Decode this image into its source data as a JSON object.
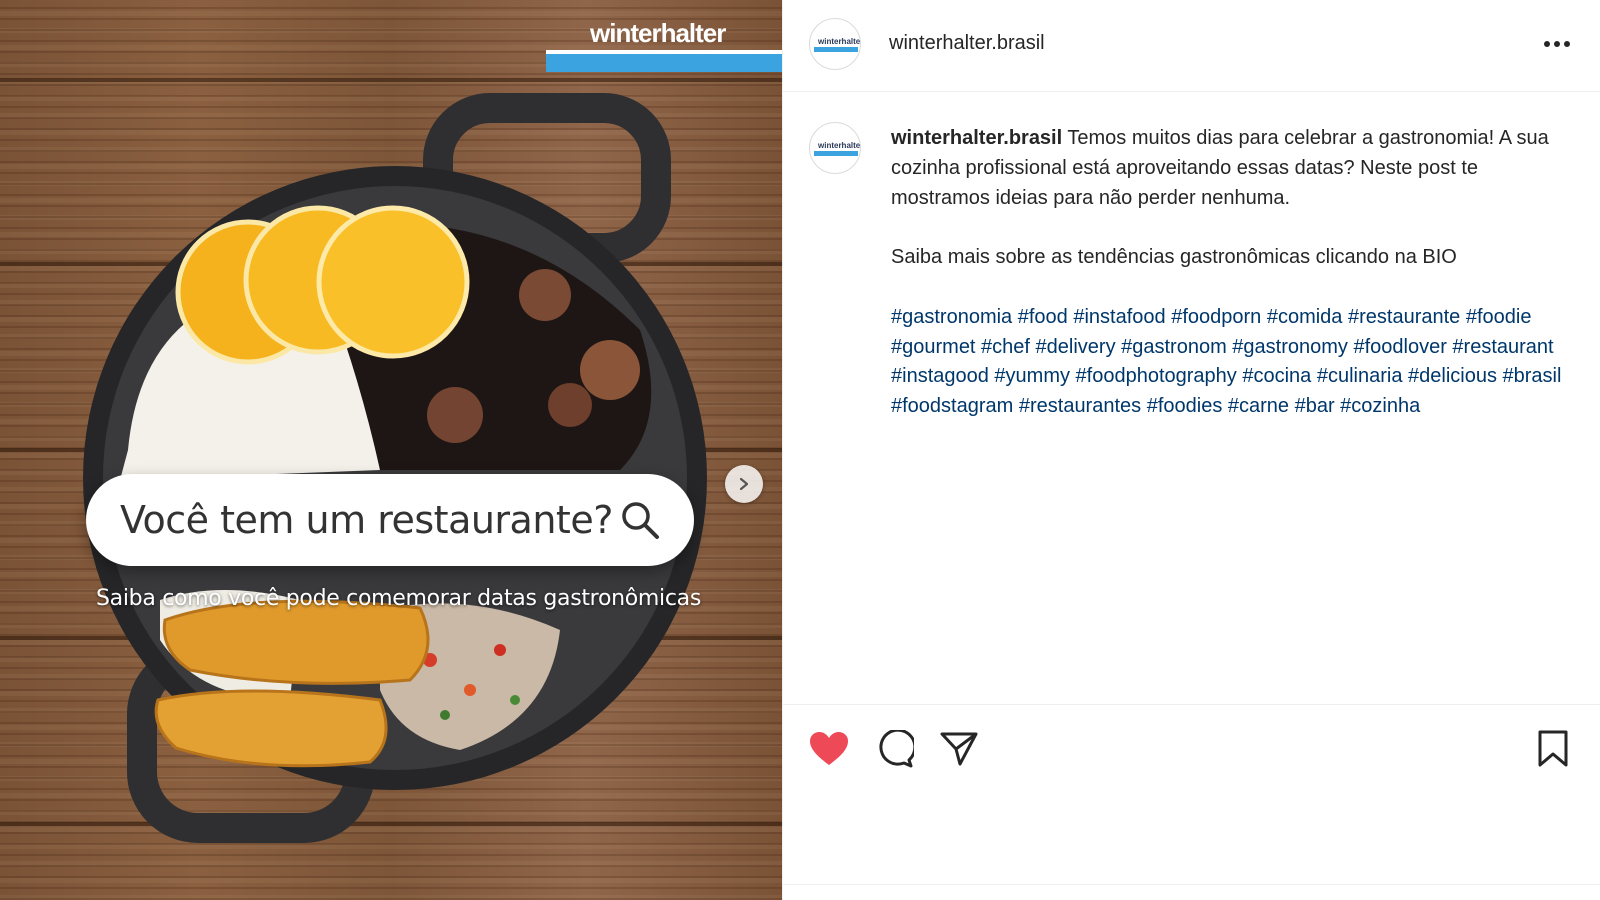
{
  "media": {
    "brand_logo": "winterhalter",
    "search_text": "Você tem um restaurante?",
    "subtitle": "Saiba como você pode comemorar datas gastronômicas",
    "next_icon": "chevron-right-icon"
  },
  "header": {
    "avatar_text": "winterhalter",
    "username": "winterhalter.brasil",
    "more_icon": "more-horizontal-icon"
  },
  "caption": {
    "avatar_text": "winterhalter",
    "username": "winterhalter.brasil",
    "paragraph_1": "Temos muitos dias para celebrar a gastronomia! A sua cozinha profissional está aproveitando essas datas? Neste post te mostramos ideias para não perder nenhuma.",
    "paragraph_2": "Saiba mais sobre as tendências gastronômicas clicando na BIO",
    "hashtags": "#gastronomia #food #instafood #foodporn #comida #restaurante #foodie #gourmet #chef #delivery #gastronom #gastronomy #foodlover #restaurant #instagood #yummy #foodphotography #cocina #culinaria #delicious #brasil #foodstagram #restaurantes #foodies #carne #bar #cozinha"
  },
  "actions": {
    "like": {
      "icon": "heart-icon",
      "active": true,
      "color": "#ed4956"
    },
    "comment": {
      "icon": "comment-icon"
    },
    "share": {
      "icon": "send-icon"
    },
    "save": {
      "icon": "bookmark-icon"
    }
  },
  "colors": {
    "brand_blue": "#3aa3e0",
    "hashtag": "#00376b",
    "like_red": "#ed4956"
  }
}
